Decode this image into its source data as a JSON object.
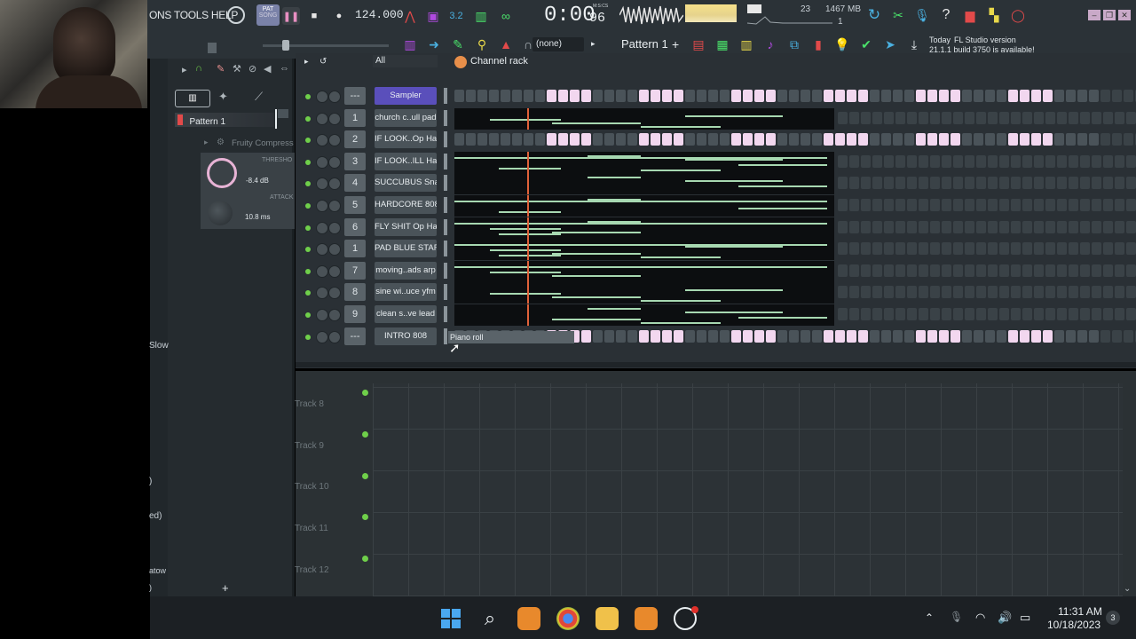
{
  "menu": {
    "items_text": "ONS TOOLS HELP"
  },
  "transport": {
    "pat_label": "PAT",
    "song_label": "SONG",
    "tempo": "124.000",
    "time_main": "0:00",
    "time_sub": "96",
    "time_unit": "M:S:CS",
    "cpu_count": "23",
    "memory": "1467 MB",
    "memory_sub": "1"
  },
  "toolbar": {
    "preset_select": "(none)",
    "pattern_name": "Pattern 1",
    "news_title": "Today",
    "news_line1": "FL Studio version",
    "news_line2": "21.1.1 build 3750 is available!"
  },
  "browser": {
    "pattern_item": "Pattern 1",
    "plugin_item": "Fruity Compress",
    "threshold_label": "THRESHO",
    "threshold_value": "-8.4 dB",
    "attack_label": "ATTACK",
    "attack_value": "10.8 ms",
    "side_text_slow": "Slow",
    "side_text_ed": "ed)",
    "side_text_atow": "atow",
    "side_text_paren": ")",
    "side_text_0": ")"
  },
  "channel_rack": {
    "filter": "All",
    "title": "Channel rack",
    "piano_roll_hint": "Piano roll",
    "channels": [
      {
        "num": "---",
        "name": "Sampler"
      },
      {
        "num": "1",
        "name": "church c..ull pad"
      },
      {
        "num": "2",
        "name": "IF LOOK..Op Hat"
      },
      {
        "num": "3",
        "name": "IF LOOK..ILL Hat"
      },
      {
        "num": "4",
        "name": "SUCCUBUS Snare"
      },
      {
        "num": "5",
        "name": "HARDCORE 808"
      },
      {
        "num": "6",
        "name": "FLY SHIT Op Hat"
      },
      {
        "num": "1",
        "name": "PAD BLUE STAR"
      },
      {
        "num": "7",
        "name": "moving..ads arp"
      },
      {
        "num": "8",
        "name": "sine wi..uce yfm"
      },
      {
        "num": "9",
        "name": "clean s..ve lead"
      },
      {
        "num": "---",
        "name": "INTRO 808"
      }
    ]
  },
  "playlist": {
    "tracks": [
      "Track 8",
      "Track 9",
      "Track 10",
      "Track 11",
      "Track 12"
    ]
  },
  "taskbar": {
    "time": "11:31 AM",
    "date": "10/18/2023",
    "badge": "3"
  }
}
